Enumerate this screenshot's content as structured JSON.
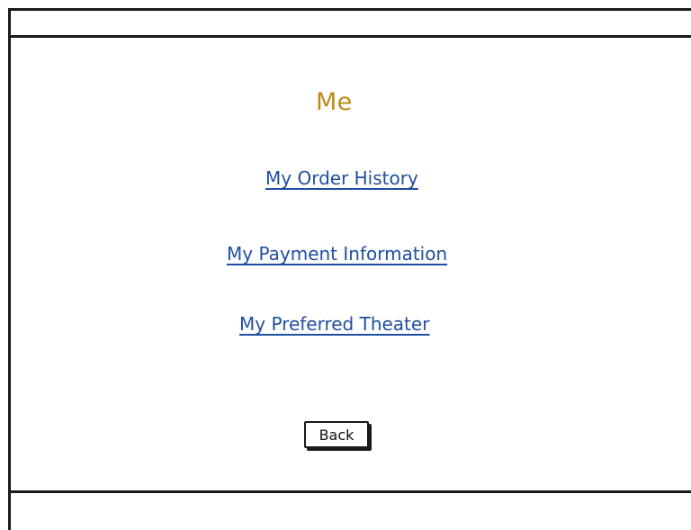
{
  "page": {
    "title": "Me"
  },
  "links": {
    "order_history": "My Order History",
    "payment_information": "My Payment Information",
    "preferred_theater": "My Preferred Theater"
  },
  "actions": {
    "back_label": "Back"
  },
  "colors": {
    "title": "#c08a17",
    "link": "#1f4fa0",
    "border": "#1a1a1a"
  }
}
